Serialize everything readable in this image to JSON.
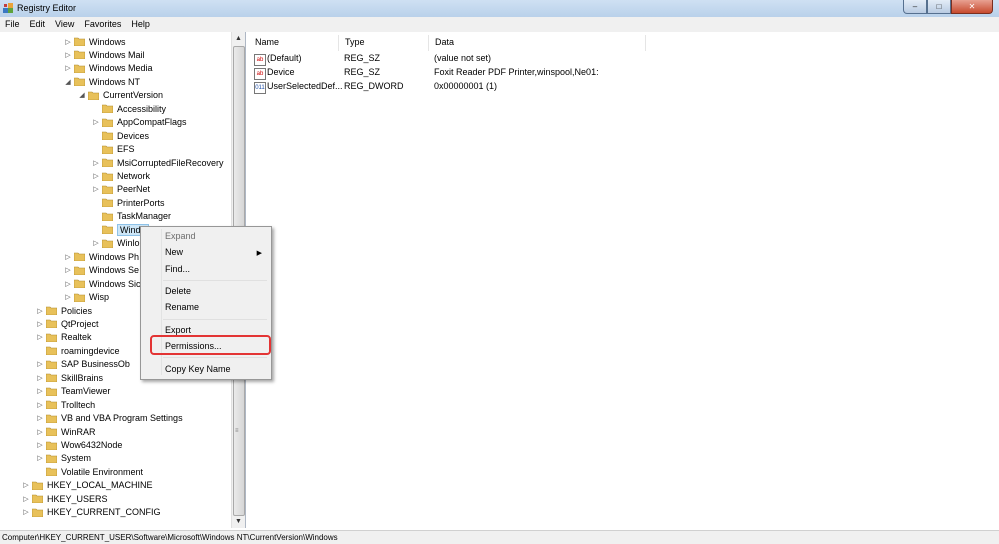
{
  "window": {
    "title": "Registry Editor",
    "minimize": "–",
    "maximize": "□",
    "close": "✕"
  },
  "menu": [
    "File",
    "Edit",
    "View",
    "Favorites",
    "Help"
  ],
  "tree": [
    {
      "label": "Windows",
      "expander": "▷"
    },
    {
      "label": "Windows Mail",
      "expander": "▷"
    },
    {
      "label": "Windows Media",
      "expander": "▷"
    },
    {
      "label": "Windows NT",
      "expander": "◢"
    },
    {
      "label": "CurrentVersion",
      "expander": "◢"
    },
    {
      "label": "Accessibility",
      "expander": ""
    },
    {
      "label": "AppCompatFlags",
      "expander": "▷"
    },
    {
      "label": "Devices",
      "expander": ""
    },
    {
      "label": "EFS",
      "expander": ""
    },
    {
      "label": "MsiCorruptedFileRecovery",
      "expander": "▷"
    },
    {
      "label": "Network",
      "expander": "▷"
    },
    {
      "label": "PeerNet",
      "expander": "▷"
    },
    {
      "label": "PrinterPorts",
      "expander": ""
    },
    {
      "label": "TaskManager",
      "expander": ""
    },
    {
      "label": "Windo",
      "expander": ""
    },
    {
      "label": "Winlo",
      "expander": "▷"
    },
    {
      "label": "Windows Ph",
      "expander": "▷"
    },
    {
      "label": "Windows Se",
      "expander": "▷"
    },
    {
      "label": "Windows Sic",
      "expander": "▷"
    },
    {
      "label": "Wisp",
      "expander": "▷"
    },
    {
      "label": "Policies",
      "expander": "▷"
    },
    {
      "label": "QtProject",
      "expander": "▷"
    },
    {
      "label": "Realtek",
      "expander": "▷"
    },
    {
      "label": "roamingdevice",
      "expander": ""
    },
    {
      "label": "SAP BusinessOb",
      "expander": "▷"
    },
    {
      "label": "SkillBrains",
      "expander": "▷"
    },
    {
      "label": "TeamViewer",
      "expander": "▷"
    },
    {
      "label": "Trolltech",
      "expander": "▷"
    },
    {
      "label": "VB and VBA Program Settings",
      "expander": "▷"
    },
    {
      "label": "WinRAR",
      "expander": "▷"
    },
    {
      "label": "Wow6432Node",
      "expander": "▷"
    },
    {
      "label": "System",
      "expander": "▷"
    },
    {
      "label": "Volatile Environment",
      "expander": ""
    },
    {
      "label": "HKEY_LOCAL_MACHINE",
      "expander": "▷"
    },
    {
      "label": "HKEY_USERS",
      "expander": "▷"
    },
    {
      "label": "HKEY_CURRENT_CONFIG",
      "expander": "▷"
    }
  ],
  "columns": {
    "name": "Name",
    "type": "Type",
    "data": "Data"
  },
  "values": [
    {
      "icon": "ab",
      "name": "(Default)",
      "type": "REG_SZ",
      "data": "(value not set)"
    },
    {
      "icon": "ab",
      "name": "Device",
      "type": "REG_SZ",
      "data": "Foxit Reader PDF Printer,winspool,Ne01:"
    },
    {
      "icon": "011",
      "name": "UserSelectedDef...",
      "type": "REG_DWORD",
      "data": "0x00000001 (1)"
    }
  ],
  "context_menu": {
    "expand": "Expand",
    "new": "New",
    "find": "Find...",
    "delete": "Delete",
    "rename": "Rename",
    "export": "Export",
    "permissions": "Permissions...",
    "copy_key_name": "Copy Key Name",
    "submenu_arrow": "▶"
  },
  "scrollbar": {
    "up": "▲",
    "down": "▼",
    "grip": "≡"
  },
  "status": {
    "path": "Computer\\HKEY_CURRENT_USER\\Software\\Microsoft\\Windows NT\\CurrentVersion\\Windows"
  },
  "colors": {
    "folder": "#e8c15a",
    "selection": "#cde6f7",
    "highlight": "#e33434"
  }
}
